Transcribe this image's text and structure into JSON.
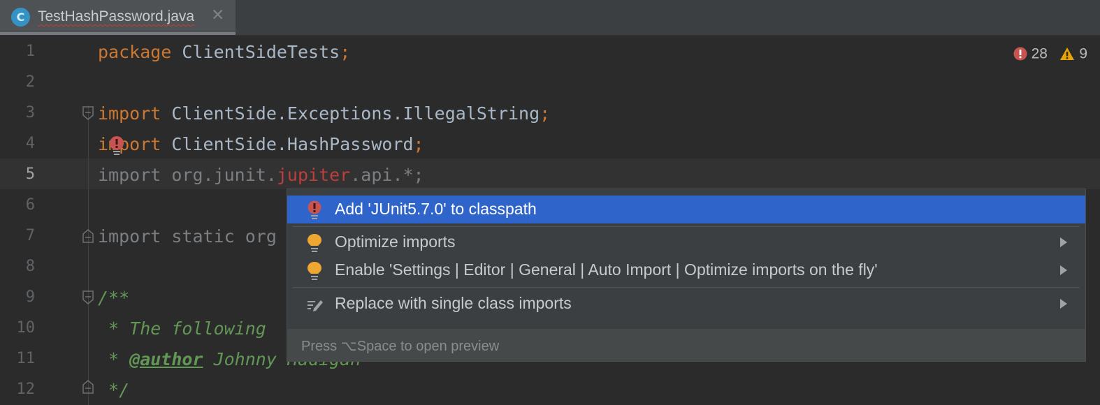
{
  "tab": {
    "icon_letter": "C",
    "title": "TestHashPassword.java",
    "close": "✕"
  },
  "inspections": {
    "errors": "28",
    "warnings": "9"
  },
  "gutter": {
    "lines": [
      "1",
      "2",
      "3",
      "4",
      "5",
      "6",
      "7",
      "8",
      "9",
      "10",
      "11",
      "12"
    ]
  },
  "code": {
    "l1_kw": "package",
    "l1_rest": " ClientSideTests",
    "l1_semi": ";",
    "l3_kw": "import",
    "l3_rest": " ClientSide.Exceptions.IllegalString",
    "l3_semi": ";",
    "l4_kw": "import",
    "l4_rest": " ClientSide.HashPassword",
    "l4_semi": ";",
    "l5_a": "import org.junit.",
    "l5_err": "jupiter",
    "l5_b": ".api.*;",
    "l7": "import static org",
    "l9": "/**",
    "l10": " * The following",
    "l11_a": " * ",
    "l11_tag": "@author",
    "l11_b": " Johnny Hadigan",
    "l12": " */"
  },
  "popup": {
    "items": [
      {
        "label": "Add 'JUnit5.7.0' to classpath",
        "icon": "error-bulb-icon",
        "selected": true
      },
      {
        "label": "Optimize imports",
        "icon": "bulb-icon",
        "submenu": true
      },
      {
        "label": "Enable 'Settings | Editor | General | Auto Import | Optimize imports on the fly'",
        "icon": "bulb-icon",
        "submenu": true
      },
      {
        "label": "Replace with single class imports",
        "icon": "edit-icon",
        "submenu": true
      }
    ],
    "footer": "Press ⌥Space to open preview"
  },
  "colors": {
    "selection": "#2f65ca",
    "keyword": "#cc7832",
    "comment": "#629755",
    "error": "#bc3f3c",
    "warning": "#e5a50a"
  }
}
